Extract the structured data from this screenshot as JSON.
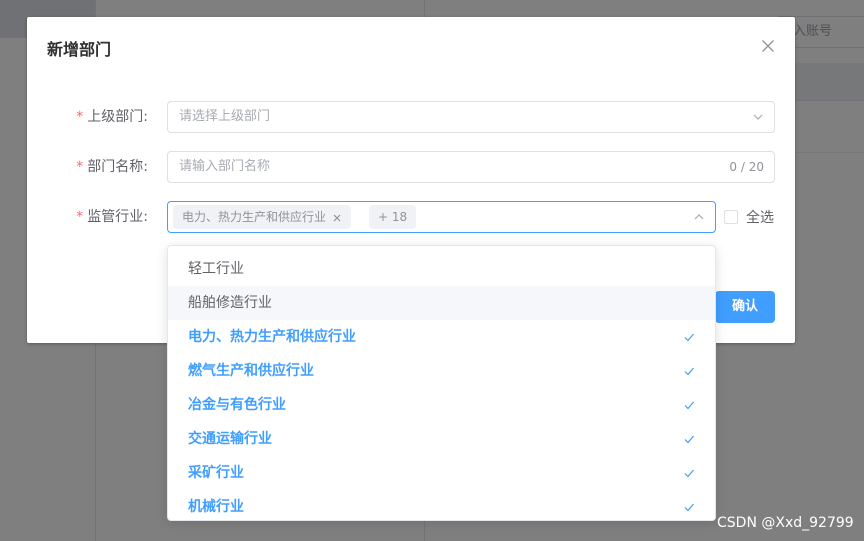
{
  "background": {
    "search_placeholder": "入账号"
  },
  "dialog": {
    "title": "新增部门",
    "form": {
      "parent_dept": {
        "required_mark": "*",
        "label": "上级部门:",
        "placeholder": "请选择上级部门"
      },
      "dept_name": {
        "required_mark": "*",
        "label": "部门名称:",
        "placeholder": "请输入部门名称",
        "counter": "0 / 20"
      },
      "industry": {
        "required_mark": "*",
        "label": "监管行业:",
        "selected_tag": "电力、热力生产和供应行业",
        "more_tag": "+ 18",
        "select_all_label": "全选",
        "select_all_checked": false
      }
    },
    "confirm_label": "确认"
  },
  "dropdown": {
    "options": [
      {
        "label": "轻工行业",
        "selected": false,
        "hover": false
      },
      {
        "label": "船舶修造行业",
        "selected": false,
        "hover": true
      },
      {
        "label": "电力、热力生产和供应行业",
        "selected": true,
        "hover": false
      },
      {
        "label": "燃气生产和供应行业",
        "selected": true,
        "hover": false
      },
      {
        "label": "冶金与有色行业",
        "selected": true,
        "hover": false
      },
      {
        "label": "交通运输行业",
        "selected": true,
        "hover": false
      },
      {
        "label": "采矿行业",
        "selected": true,
        "hover": false
      },
      {
        "label": "机械行业",
        "selected": true,
        "hover": false
      }
    ]
  },
  "watermark": "CSDN @Xxd_92799",
  "colors": {
    "primary": "#409eff",
    "required": "#f56c6c",
    "text": "#606266",
    "placeholder": "#a8abb2"
  }
}
